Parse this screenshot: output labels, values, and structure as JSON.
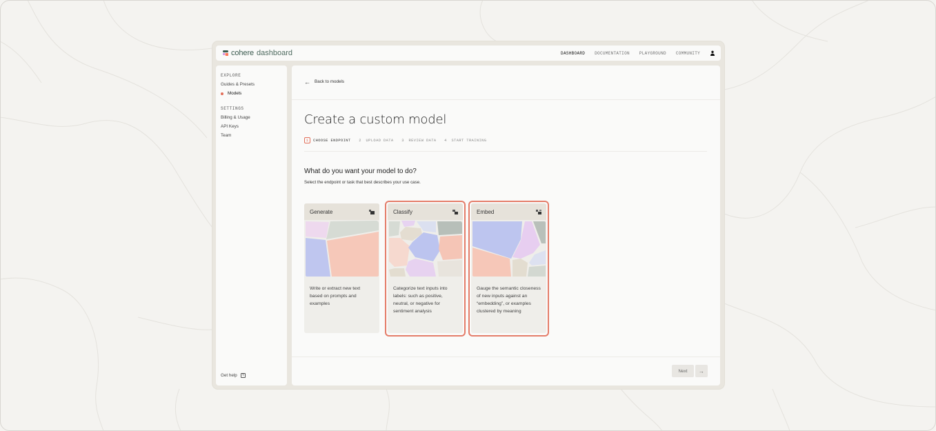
{
  "brand": {
    "name": "cohere",
    "product": "dashboard"
  },
  "topnav": [
    {
      "label": "DASHBOARD",
      "active": true
    },
    {
      "label": "DOCUMENTATION",
      "active": false
    },
    {
      "label": "PLAYGROUND",
      "active": false
    },
    {
      "label": "COMMUNITY",
      "active": false
    }
  ],
  "sidebar": {
    "explore_heading": "EXPLORE",
    "explore_items": [
      {
        "label": "Guides & Presets",
        "active": false
      },
      {
        "label": "Models",
        "active": true
      }
    ],
    "settings_heading": "SETTINGS",
    "settings_items": [
      {
        "label": "Billing & Usage"
      },
      {
        "label": "API Keys"
      },
      {
        "label": "Team"
      }
    ],
    "help_label": "Get help",
    "help_icon": "?"
  },
  "main": {
    "back_label": "Back to models",
    "title": "Create a custom model",
    "steps": [
      {
        "num": "1",
        "label": "CHOOSE ENDPOINT",
        "active": true
      },
      {
        "num": "2",
        "label": "UPLOAD DATA",
        "active": false
      },
      {
        "num": "3",
        "label": "REVIEW DATA",
        "active": false
      },
      {
        "num": "4",
        "label": "START TRAINING",
        "active": false
      }
    ],
    "question": "What do you want your model to do?",
    "question_sub": "Select the endpoint or task that best describes your use case.",
    "cards": [
      {
        "name": "Generate",
        "description": "Write or extract new text based on prompts and examples",
        "highlighted": false
      },
      {
        "name": "Classify",
        "description": "Categorize text inputs into labels: such as positive, neutral, or negative for sentiment analysis",
        "highlighted": true
      },
      {
        "name": "Embed",
        "description": "Gauge the semantic closeness of new inputs against an “embedding”, or examples clustered by meaning",
        "highlighted": true
      }
    ],
    "next_label": "Next",
    "next_arrow": "→"
  },
  "colors": {
    "accent": "#e26e59",
    "highlight_outline": "#e47c69",
    "lavender": "#bec6ee",
    "peach": "#f6c7b8",
    "sage": "#d3d8d1",
    "lilac": "#e6d1f0",
    "sand": "#e3ddd0"
  }
}
